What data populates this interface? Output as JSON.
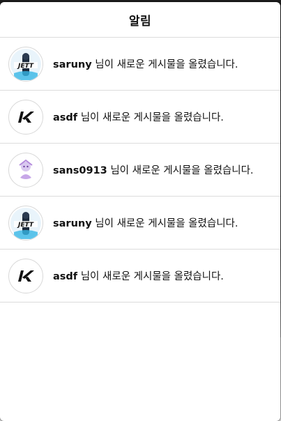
{
  "modal": {
    "title": "알림"
  },
  "notifications": [
    {
      "username": "saruny",
      "message": "님이 새로운 게시물을 올렸습니다.",
      "avatar_icon": "jett-avatar-icon"
    },
    {
      "username": "asdf",
      "message": "님이 새로운 게시물을 올렸습니다.",
      "avatar_icon": "k-logo-icon"
    },
    {
      "username": "sans0913",
      "message": "님이 새로운 게시물을 올렸습니다.",
      "avatar_icon": "purple-character-icon"
    },
    {
      "username": "saruny",
      "message": "님이 새로운 게시물을 올렸습니다.",
      "avatar_icon": "jett-avatar-icon"
    },
    {
      "username": "asdf",
      "message": "님이 새로운 게시물을 올렸습니다.",
      "avatar_icon": "k-logo-icon"
    }
  ],
  "colors": {
    "text": "#111111",
    "divider": "#dcdcdc",
    "modal_bg": "#ffffff"
  }
}
